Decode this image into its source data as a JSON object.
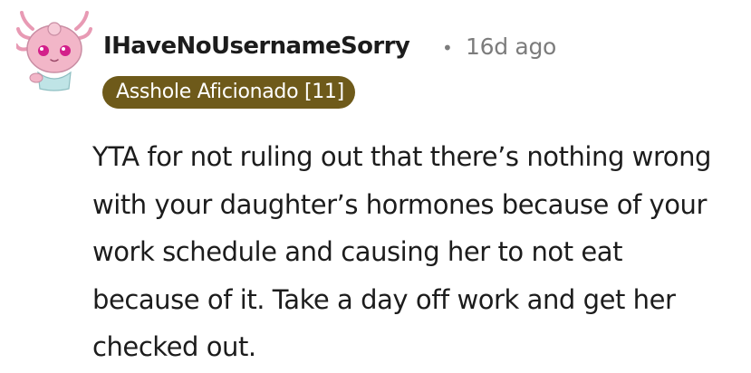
{
  "comment": {
    "author": "IHaveNoUsernameSorry",
    "separator": "•",
    "timestamp": "16d ago",
    "flair": "Asshole Aficionado [11]",
    "body": "YTA for not ruling out that there’s nothing wrong with your daughter’s hormones because of your work schedule and causing her to not eat because of it. Take a day off work and get her checked out."
  },
  "colors": {
    "flair_background": "#6e5a1a",
    "flair_text": "#ffffff",
    "meta_text": "#7c7c7c",
    "avatar_body": "#f2b6c8",
    "avatar_eye": "#d31f8a"
  },
  "icons": {
    "avatar": "axolotl-snoo-avatar-icon"
  }
}
